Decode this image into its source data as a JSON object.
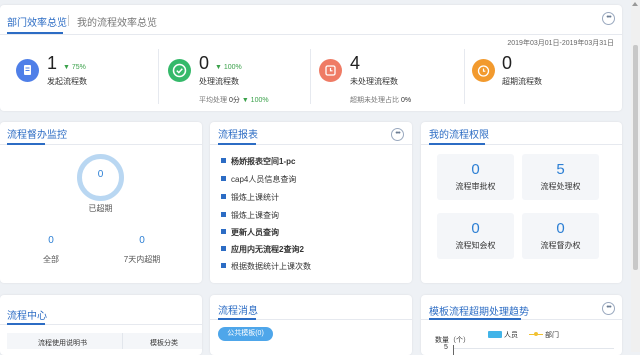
{
  "overview": {
    "tabs": [
      {
        "label": "部门效率总览"
      },
      {
        "label": "我的流程效率总览"
      }
    ],
    "date_range": "2019年03月01日-2019年03月31日",
    "stats": [
      {
        "value": "1",
        "change": "▼ 75%",
        "label": "发起流程数"
      },
      {
        "value": "0",
        "change": "▼ 100%",
        "label": "处理流程数",
        "sub_label": "平均处理",
        "sub_value": "0分",
        "sub_change": "▼ 100%"
      },
      {
        "value": "4",
        "label": "未处理流程数",
        "sub_label": "超期未处理占比",
        "sub_value": "0%"
      },
      {
        "value": "0",
        "label": "超期流程数"
      }
    ]
  },
  "monitor": {
    "title": "流程督办监控",
    "ring_value": "0",
    "ring_label": "已超期",
    "total_value": "0",
    "total_label": "全部",
    "week_value": "0",
    "week_label": "7天内超期"
  },
  "report": {
    "title": "流程报表",
    "items": [
      {
        "label": "杨娇报表空间1-pc",
        "bold": true
      },
      {
        "label": "cap4人员信息查询"
      },
      {
        "label": "锻炼上课统计"
      },
      {
        "label": "锻炼上课查询"
      },
      {
        "label": "更新人员查询",
        "bold": true
      },
      {
        "label": "应用内无流程2查询2",
        "bold": true
      },
      {
        "label": "根据数据统计上课次数"
      }
    ]
  },
  "permissions": {
    "title": "我的流程权限",
    "items": [
      {
        "value": "0",
        "label": "流程审批权"
      },
      {
        "value": "5",
        "label": "流程处理权"
      },
      {
        "value": "0",
        "label": "流程知会权"
      },
      {
        "value": "0",
        "label": "流程督办权"
      }
    ]
  },
  "center": {
    "title": "流程中心",
    "col1": "流程使用说明书",
    "col2": "模板分类"
  },
  "messages": {
    "title": "流程消息",
    "chip": "公共模板(0)"
  },
  "trend": {
    "title": "模板流程超期处理趋势",
    "legend": [
      "人员",
      "部门"
    ],
    "ylabel": "数量（个）",
    "ytick": "5"
  },
  "colors": {
    "accent": "#2c6cc4",
    "green": "#3aa14a",
    "blue_icon": "#4f7fe8",
    "green_icon": "#35b96a",
    "red_icon": "#ef7b65",
    "orange_icon": "#f29a2e"
  }
}
